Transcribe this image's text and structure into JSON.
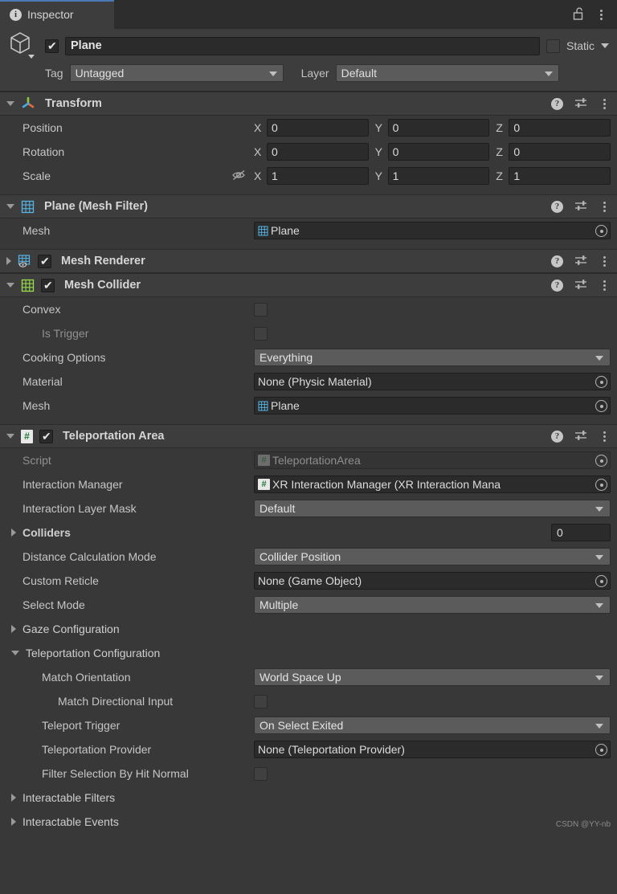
{
  "window": {
    "tab_label": "Inspector",
    "tab_icon": "info-icon",
    "lock_icon": "lock-open-icon",
    "menu_icon": "kebab-menu-icon"
  },
  "object_header": {
    "prefab_icon": "cube-icon",
    "enabled": true,
    "name": "Plane",
    "static_label": "Static",
    "static_checked": false,
    "tag_label": "Tag",
    "tag_value": "Untagged",
    "layer_label": "Layer",
    "layer_value": "Default"
  },
  "components": [
    {
      "id": "transform",
      "title": "Transform",
      "icon": "transform-axis-icon",
      "expanded": true,
      "has_checkbox": false,
      "rows": [
        {
          "type": "vector3",
          "label": "Position",
          "axes": [
            "X",
            "Y",
            "Z"
          ],
          "values": [
            "0",
            "0",
            "0"
          ]
        },
        {
          "type": "vector3",
          "label": "Rotation",
          "axes": [
            "X",
            "Y",
            "Z"
          ],
          "values": [
            "0",
            "0",
            "0"
          ]
        },
        {
          "type": "vector3",
          "label": "Scale",
          "axes": [
            "X",
            "Y",
            "Z"
          ],
          "values": [
            "1",
            "1",
            "1"
          ],
          "lock_icon": "constrain-proportions-off-icon"
        }
      ]
    },
    {
      "id": "mesh-filter",
      "title": "Plane (Mesh Filter)",
      "icon": "mesh-filter-icon",
      "expanded": true,
      "has_checkbox": false,
      "rows": [
        {
          "type": "object",
          "label": "Mesh",
          "value": "Plane",
          "value_icon": "mesh-icon"
        }
      ]
    },
    {
      "id": "mesh-renderer",
      "title": "Mesh Renderer",
      "icon": "mesh-renderer-icon",
      "expanded": false,
      "has_checkbox": true,
      "checked": true,
      "rows": []
    },
    {
      "id": "mesh-collider",
      "title": "Mesh Collider",
      "icon": "mesh-collider-icon",
      "expanded": true,
      "has_checkbox": true,
      "checked": true,
      "rows": [
        {
          "type": "checkbox",
          "label": "Convex",
          "checked": false
        },
        {
          "type": "checkbox",
          "label": "Is Trigger",
          "checked": false,
          "indent": 2,
          "dim": true
        },
        {
          "type": "dropdown",
          "label": "Cooking Options",
          "value": "Everything"
        },
        {
          "type": "object",
          "label": "Material",
          "value": "None (Physic Material)"
        },
        {
          "type": "object",
          "label": "Mesh",
          "value": "Plane",
          "value_icon": "mesh-icon"
        }
      ]
    },
    {
      "id": "teleportation-area",
      "title": "Teleportation Area",
      "icon": "cs-script-icon",
      "expanded": true,
      "has_checkbox": true,
      "checked": true,
      "rows": [
        {
          "type": "object",
          "label": "Script",
          "value": "TeleportationArea",
          "value_icon": "cs-script-icon",
          "dim": true
        },
        {
          "type": "object",
          "label": "Interaction Manager",
          "value": "XR Interaction Manager (XR Interaction Mana",
          "value_icon": "cs-script-icon"
        },
        {
          "type": "dropdown",
          "label": "Interaction Layer Mask",
          "value": "Default"
        },
        {
          "type": "foldout-count",
          "label": "Colliders",
          "expanded": false,
          "count": "0"
        },
        {
          "type": "dropdown",
          "label": "Distance Calculation Mode",
          "value": "Collider Position"
        },
        {
          "type": "object",
          "label": "Custom Reticle",
          "value": "None (Game Object)"
        },
        {
          "type": "dropdown",
          "label": "Select Mode",
          "value": "Multiple"
        },
        {
          "type": "foldout",
          "label": "Gaze Configuration",
          "expanded": false
        },
        {
          "type": "foldout",
          "label": "Teleportation Configuration",
          "expanded": true
        },
        {
          "type": "dropdown",
          "label": "Match Orientation",
          "value": "World Space Up",
          "indent": 2
        },
        {
          "type": "checkbox",
          "label": "Match Directional Input",
          "checked": false,
          "indent": 3
        },
        {
          "type": "dropdown",
          "label": "Teleport Trigger",
          "value": "On Select Exited",
          "indent": 2
        },
        {
          "type": "object",
          "label": "Teleportation Provider",
          "value": "None (Teleportation Provider)",
          "indent": 2
        },
        {
          "type": "checkbox",
          "label": "Filter Selection By Hit Normal",
          "checked": false,
          "indent": 2
        },
        {
          "type": "foldout",
          "label": "Interactable Filters",
          "expanded": false
        },
        {
          "type": "foldout",
          "label": "Interactable Events",
          "expanded": false
        }
      ]
    }
  ],
  "watermark": "CSDN @YY-nb",
  "colors": {
    "panel_bg": "#383838",
    "header_bg": "#3d3d3d",
    "tabbar_bg": "#2d2d2d",
    "field_bg": "#2b2b2b",
    "dropdown_bg": "#5b5b5b",
    "accent_tab": "#4a79b5",
    "text": "#c6c6c6"
  }
}
